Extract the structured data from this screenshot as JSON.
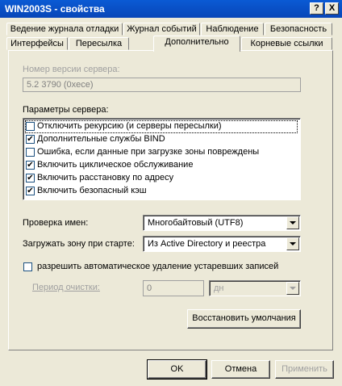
{
  "window": {
    "title": "WIN2003S - свойства",
    "help_label": "?",
    "close_label": "X"
  },
  "tabs_row1": [
    {
      "label": "Ведение журнала отладки"
    },
    {
      "label": "Журнал событий"
    },
    {
      "label": "Наблюдение"
    },
    {
      "label": "Безопасность"
    }
  ],
  "tabs_row2": [
    {
      "label": "Интерфейсы"
    },
    {
      "label": "Пересылка"
    },
    {
      "label": "Дополнительно",
      "active": true
    },
    {
      "label": "Корневые ссылки"
    }
  ],
  "version": {
    "label": "Номер версии сервера:",
    "value": "5.2 3790 (0xece)"
  },
  "params": {
    "label": "Параметры сервера:",
    "options": [
      {
        "label": "Отключить рекурсию (и серверы пересылки)",
        "checked": false,
        "mark": ""
      },
      {
        "label": "Дополнительные службы BIND",
        "checked": true,
        "mark": "✔"
      },
      {
        "label": "Ошибка, если данные при загрузке зоны повреждены",
        "checked": false,
        "mark": ""
      },
      {
        "label": "Включить циклическое обслуживание",
        "checked": true,
        "mark": "✔"
      },
      {
        "label": "Включить расстановку по адресу",
        "checked": true,
        "mark": "✔"
      },
      {
        "label": "Включить безопасный кэш",
        "checked": true,
        "mark": "✔"
      }
    ]
  },
  "name_check": {
    "label": "Проверка имен:",
    "value": "Многобайтовый (UTF8)"
  },
  "load_zone": {
    "label": "Загружать зону при старте:",
    "value": "Из Active Directory и реестра"
  },
  "auto_cleanup": {
    "label": "разрешить автоматическое удаление устаревших записей",
    "checked": false
  },
  "cleanup_period": {
    "label": "Период очистки:",
    "value": "0",
    "unit": "дн"
  },
  "restore_defaults_label": "Восстановить умолчания",
  "buttons": {
    "ok": "OK",
    "cancel": "Отмена",
    "apply": "Применить"
  },
  "colors": {
    "titlebar": "#0a5ad4",
    "face": "#ece9d8",
    "disabled_text": "#a0a0a0"
  }
}
